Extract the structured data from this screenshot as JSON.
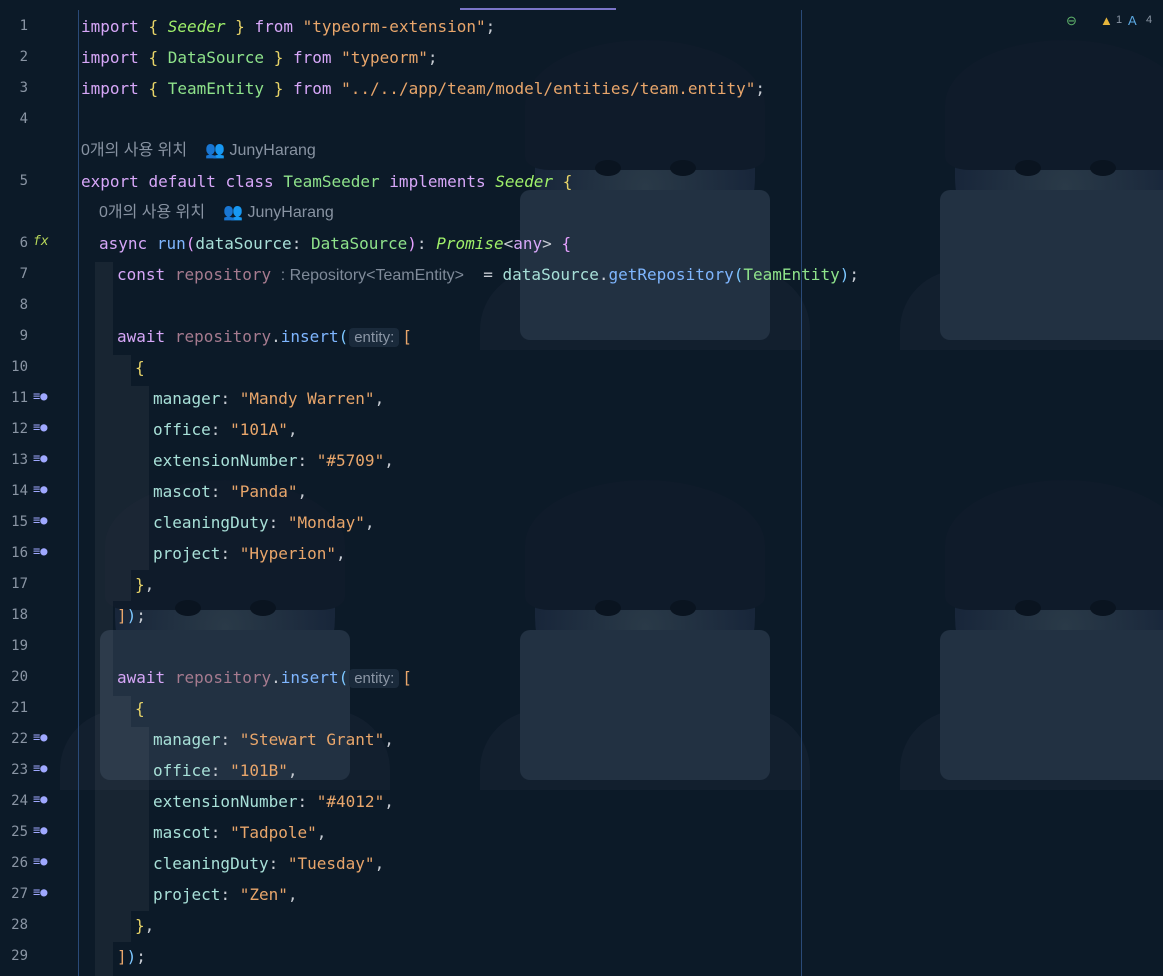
{
  "usage_hint": "0개의 사용 위치",
  "author": "JunyHarang",
  "status": {
    "warnings": "1",
    "typos": "4"
  },
  "inlay_entity": "entity:",
  "type_hint": ": Repository<TeamEntity>",
  "lines": {
    "ln1": "1",
    "ln2": "2",
    "ln3": "3",
    "ln4": "4",
    "ln5": "5",
    "ln6": "6",
    "ln7": "7",
    "ln8": "8",
    "ln9": "9",
    "ln10": "10",
    "ln11": "11",
    "ln12": "12",
    "ln13": "13",
    "ln14": "14",
    "ln15": "15",
    "ln16": "16",
    "ln17": "17",
    "ln18": "18",
    "ln19": "19",
    "ln20": "20",
    "ln21": "21",
    "ln22": "22",
    "ln23": "23",
    "ln24": "24",
    "ln25": "25",
    "ln26": "26",
    "ln27": "27",
    "ln28": "28",
    "ln29": "29"
  },
  "imports": [
    {
      "kw": "import",
      "name": "Seeder",
      "from": "from",
      "module": "\"typeorm-extension\""
    },
    {
      "kw": "import",
      "name": "DataSource",
      "from": "from",
      "module": "\"typeorm\""
    },
    {
      "kw": "import",
      "name": "TeamEntity",
      "from": "from",
      "module": "\"../../app/team/model/entities/team.entity\""
    }
  ],
  "class_line": {
    "export": "export",
    "default": "default",
    "class": "class",
    "name": "TeamSeeder",
    "implements": "implements",
    "iface": "Seeder"
  },
  "run_line": {
    "async": "async",
    "fn": "run",
    "param": "dataSource",
    "ptype": "DataSource",
    "ret": "Promise",
    "generic": "any"
  },
  "const_line": {
    "const": "const",
    "var": "repository",
    "obj": "dataSource",
    "method": "getRepository",
    "arg": "TeamEntity"
  },
  "await_kw": "await",
  "repo": "repository",
  "insert": "insert",
  "team1": {
    "manager": "\"Mandy Warren\"",
    "office": "\"101A\"",
    "extensionNumber": "\"#5709\"",
    "mascot": "\"Panda\"",
    "cleaningDuty": "\"Monday\"",
    "project": "\"Hyperion\""
  },
  "team2": {
    "manager": "\"Stewart Grant\"",
    "office": "\"101B\"",
    "extensionNumber": "\"#4012\"",
    "mascot": "\"Tadpole\"",
    "cleaningDuty": "\"Tuesday\"",
    "project": "\"Zen\""
  },
  "keys": {
    "manager": "manager",
    "office": "office",
    "extensionNumber": "extensionNumber",
    "mascot": "mascot",
    "cleaningDuty": "cleaningDuty",
    "project": "project"
  }
}
